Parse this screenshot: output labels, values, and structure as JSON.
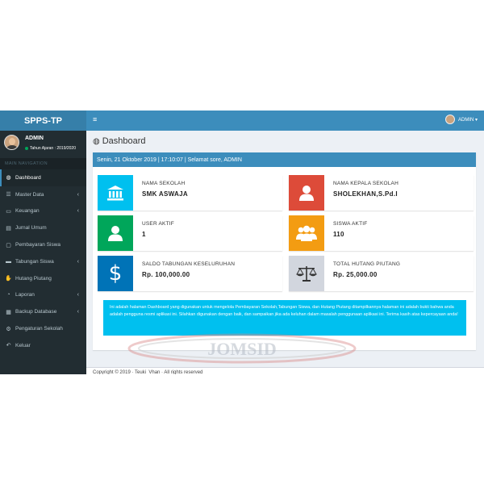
{
  "app": {
    "logo": "SPPS-TP"
  },
  "user": {
    "name": "ADMIN",
    "status": "Tahun Ajaran : 2019/2020",
    "nav_name": "ADMIN ▾"
  },
  "sidebar": {
    "header": "MAIN NAVIGATION",
    "items": [
      {
        "label": "Dashboard",
        "icon": "dashboard-icon",
        "glyph": "◍",
        "chevron": ""
      },
      {
        "label": "Master Data",
        "icon": "list-icon",
        "glyph": "☰",
        "chevron": "‹"
      },
      {
        "label": "Keuangan",
        "icon": "credit-card-icon",
        "glyph": "▭",
        "chevron": "‹"
      },
      {
        "label": "Jurnal Umum",
        "icon": "book-icon",
        "glyph": "▤",
        "chevron": ""
      },
      {
        "label": "Pembayaran Siswa",
        "icon": "file-icon",
        "glyph": "▢",
        "chevron": ""
      },
      {
        "label": "Tabungan Siswa",
        "icon": "wallet-icon",
        "glyph": "▬",
        "chevron": "‹"
      },
      {
        "label": "Hutang Piutang",
        "icon": "handshake-icon",
        "glyph": "✋",
        "chevron": ""
      },
      {
        "label": "Laporan",
        "icon": "pie-chart-icon",
        "glyph": "◔",
        "chevron": "‹"
      },
      {
        "label": "Backup Database",
        "icon": "database-icon",
        "glyph": "▦",
        "chevron": "‹"
      },
      {
        "label": "Pengaturan Sekolah",
        "icon": "gears-icon",
        "glyph": "⚙",
        "chevron": ""
      },
      {
        "label": "Keluar",
        "icon": "reply-icon",
        "glyph": "↶",
        "chevron": ""
      }
    ]
  },
  "header": {
    "toggle": "≡"
  },
  "main": {
    "title": "Dashboard",
    "greeting": "Senin, 21 Oktober 2019 | 17:10:07 | Selamat sore, ADMIN",
    "cards": [
      {
        "label": "NAMA SEKOLAH",
        "value": "SMK ASWAJA",
        "icon": "bank-icon",
        "color": "#00c0ef"
      },
      {
        "label": "NAMA KEPALA SEKOLAH",
        "value": "SHOLEKHAN,S.Pd.I",
        "icon": "user-icon",
        "color": "#dd4b39"
      },
      {
        "label": "USER AKTIF",
        "value": "1",
        "icon": "user-icon",
        "color": "#00a65a"
      },
      {
        "label": "SISWA AKTIF",
        "value": "110",
        "icon": "users-icon",
        "color": "#f39c12"
      },
      {
        "label": "SALDO TABUNGAN KESELURUHAN",
        "value": "Rp. 100,000.00",
        "icon": "dollar-icon",
        "color": "#0073b7"
      },
      {
        "label": "TOTAL HUTANG PIUTANG",
        "value": "Rp. 25,000.00",
        "icon": "balance-scale-icon",
        "color": "#d2d6de"
      }
    ],
    "info": "Ini adalah halaman Dashboard yang digunakan untuk mengelola Pembayaran Sekolah,Tabungan Siswa, dan Hutang Piutang ditampilkannya halaman ini adalah bukti bahwa anda adalah pengguna resmi aplikasi ini. Silahkan digunakan dengan baik, dan sampaikan jika ada keluhan dalam masalah penggunaan aplikasi ini. Terima kasih atas kepercayaan anda!"
  },
  "footer": {
    "text": "Copyright © 2019 · Teuki_Vhan · All rights reserved"
  },
  "watermark": {
    "text": "JOMSID"
  }
}
